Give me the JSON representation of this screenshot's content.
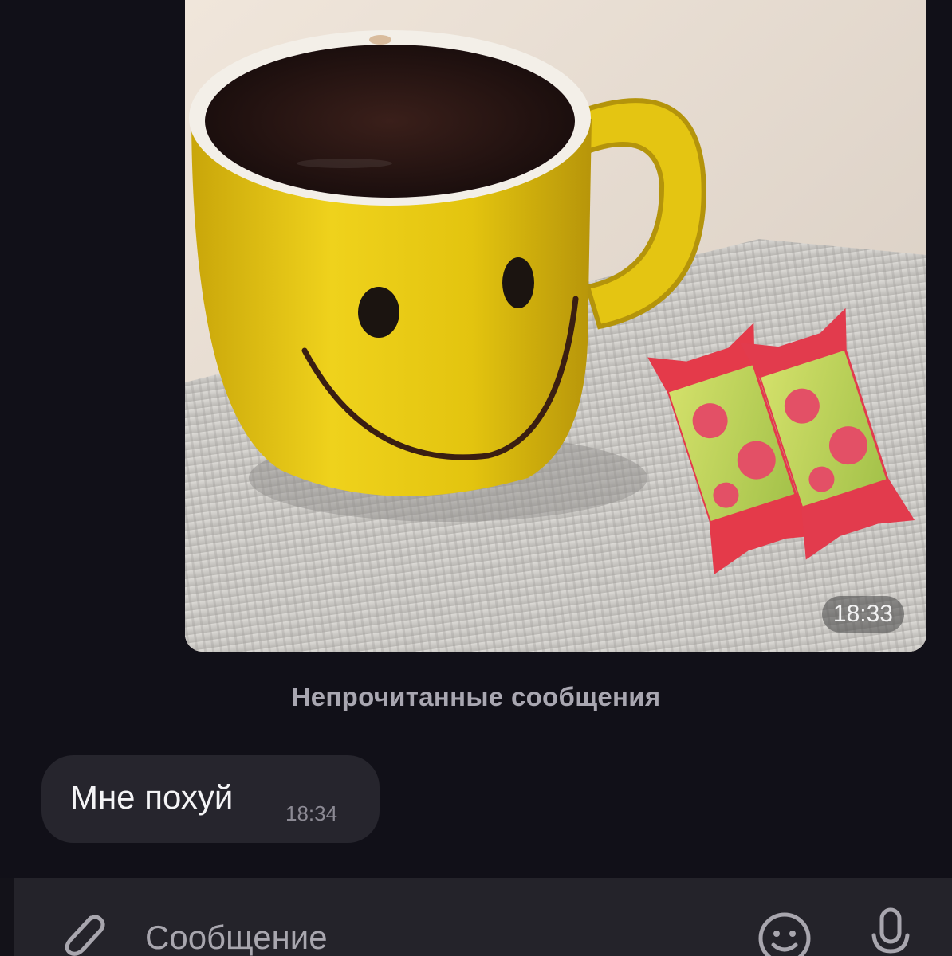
{
  "photo_message": {
    "time": "18:33"
  },
  "divider": {
    "label": "Непрочитанные сообщения"
  },
  "text_message": {
    "text": "Мне похуй",
    "time": "18:34"
  },
  "composer": {
    "placeholder": "Сообщение",
    "attach_icon": "paperclip-icon",
    "emoji_icon": "smiley-icon",
    "voice_icon": "microphone-icon"
  },
  "colors": {
    "background": "#111018",
    "bubble": "#26252d",
    "composer": "#24232a"
  }
}
